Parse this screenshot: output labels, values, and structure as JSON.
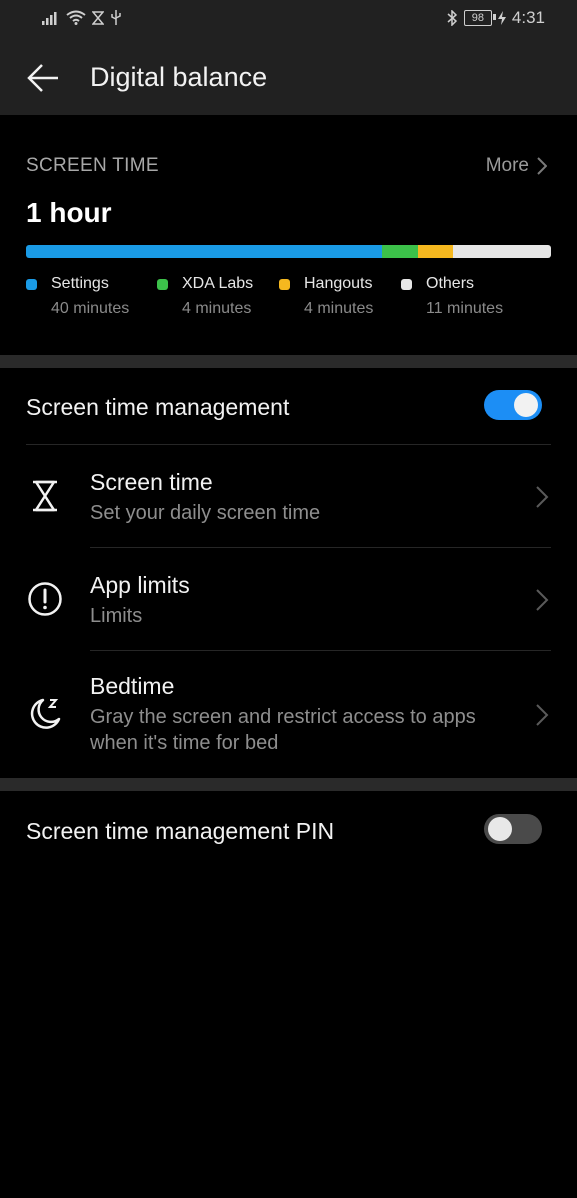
{
  "statusbar": {
    "battery": "98",
    "time": "4:31"
  },
  "appbar": {
    "title": "Digital balance"
  },
  "screen_time": {
    "label": "SCREEN TIME",
    "more": "More",
    "total": "1 hour",
    "apps": [
      {
        "name": "Settings",
        "duration": "40 minutes",
        "minutes": 40,
        "color": "#1a9be6"
      },
      {
        "name": "XDA Labs",
        "duration": "4 minutes",
        "minutes": 4,
        "color": "#3cc14a"
      },
      {
        "name": "Hangouts",
        "duration": "4 minutes",
        "minutes": 4,
        "color": "#f5b81f"
      },
      {
        "name": "Others",
        "duration": "11 minutes",
        "minutes": 11,
        "color": "#e6e6e6"
      }
    ]
  },
  "management": {
    "title": "Screen time management",
    "enabled": true
  },
  "rows": [
    {
      "title": "Screen time",
      "subtitle": "Set your daily screen time",
      "icon": "hourglass-icon"
    },
    {
      "title": "App limits",
      "subtitle": "Limits",
      "icon": "alert-circle-icon"
    },
    {
      "title": "Bedtime",
      "subtitle_line1": "Gray the screen and restrict access to apps",
      "subtitle_line2": "when it's time for bed",
      "icon": "moon-icon"
    }
  ],
  "pin": {
    "title": "Screen time management PIN",
    "enabled": false
  },
  "colors": {
    "accent": "#1c8ef5",
    "background": "#000000",
    "appbar": "#212121"
  }
}
